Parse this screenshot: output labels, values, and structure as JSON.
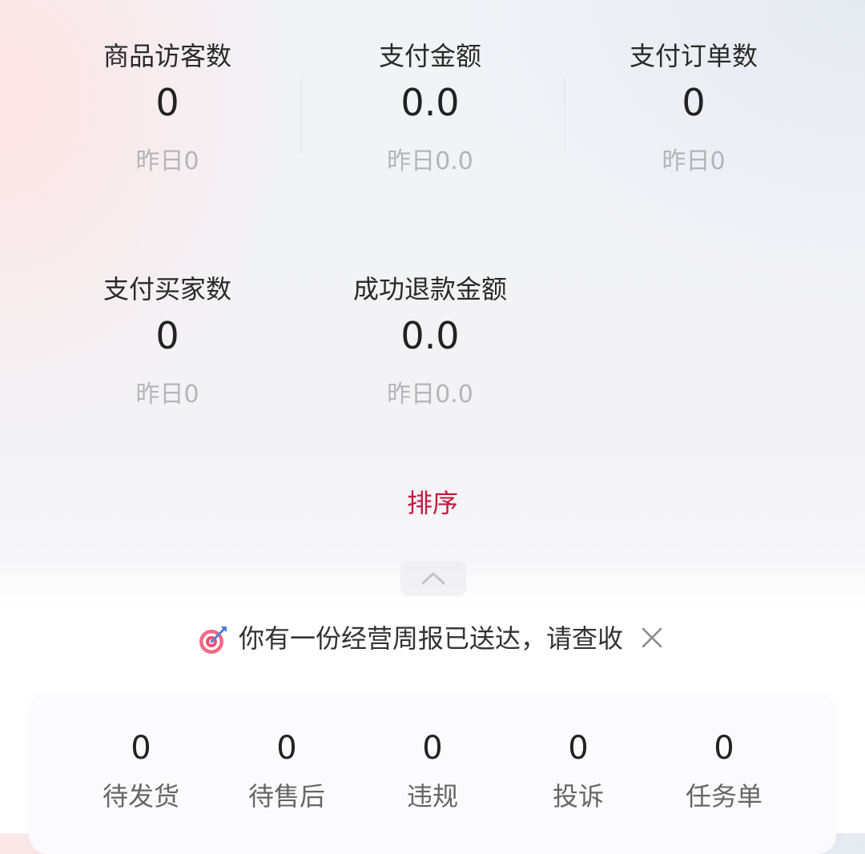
{
  "metrics": [
    {
      "label": "商品访客数",
      "value": "0",
      "yesterday": "昨日0"
    },
    {
      "label": "支付金额",
      "value": "0.0",
      "yesterday": "昨日0.0"
    },
    {
      "label": "支付订单数",
      "value": "0",
      "yesterday": "昨日0"
    },
    {
      "label": "支付买家数",
      "value": "0",
      "yesterday": "昨日0"
    },
    {
      "label": "成功退款金额",
      "value": "0.0",
      "yesterday": "昨日0.0"
    }
  ],
  "sort_label": "排序",
  "notice": {
    "icon": "target-icon",
    "text": "你有一份经营周报已送达，请查收"
  },
  "todos": [
    {
      "value": "0",
      "label": "待发货"
    },
    {
      "value": "0",
      "label": "待售后"
    },
    {
      "value": "0",
      "label": "违规"
    },
    {
      "value": "0",
      "label": "投诉"
    },
    {
      "value": "0",
      "label": "任务单"
    }
  ],
  "colors": {
    "accent": "#c8163e",
    "muted": "#b5b5b8",
    "text": "#222222"
  }
}
